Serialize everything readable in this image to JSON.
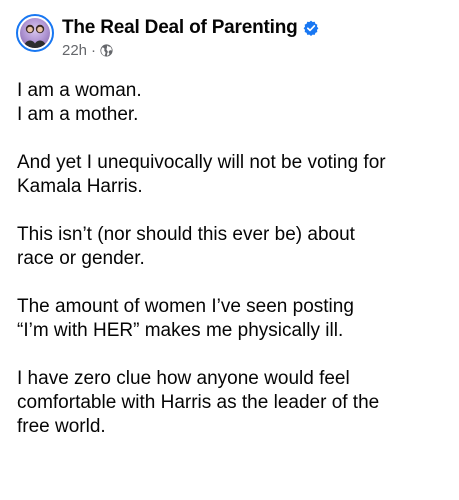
{
  "post": {
    "author": "The Real Deal of Parenting",
    "timestamp": "22h",
    "separator": "·",
    "verified_icon": "verified-badge-icon",
    "privacy_icon": "globe-icon",
    "accent_color": "#1877f2",
    "meta_color": "#65676b",
    "paragraphs": [
      {
        "lines": [
          "I am a woman.",
          "I am a mother."
        ]
      },
      {
        "lines": [
          "And yet I unequivocally will not be voting for",
          "Kamala Harris."
        ]
      },
      {
        "lines": [
          "This isn’t (nor should this ever be) about",
          "race or gender."
        ]
      },
      {
        "lines": [
          "The amount of women I’ve seen posting",
          "“I’m with HER” makes me physically ill."
        ]
      },
      {
        "lines": [
          "I have zero clue how anyone would feel",
          "comfortable with Harris as the leader of the",
          "free world."
        ]
      }
    ]
  }
}
